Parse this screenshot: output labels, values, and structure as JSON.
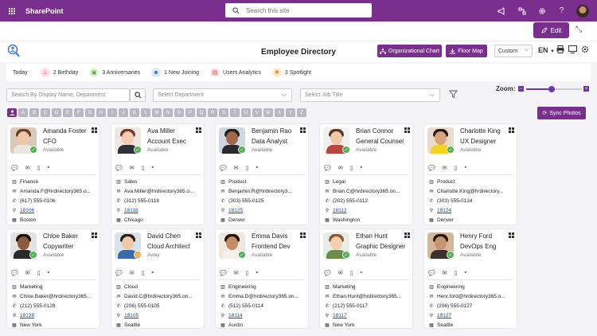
{
  "topbar": {
    "brand": "SharePoint",
    "search_placeholder": "Search this site"
  },
  "edit_label": "Edit",
  "header": {
    "title": "Employee Directory",
    "org_chart": "Organizational Chart",
    "floor_map": "Floor Map",
    "view": "Custom",
    "lang": "EN"
  },
  "tabs": [
    {
      "label": "Today"
    },
    {
      "label": "2 Birthday"
    },
    {
      "label": "3 Anniversaries"
    },
    {
      "label": "1 New Joining"
    },
    {
      "label": "Users Analytics"
    },
    {
      "label": "3 Spotlight"
    }
  ],
  "filters": {
    "search_placeholder": "Search By Display Name, Department",
    "department_placeholder": "Select Department",
    "job_placeholder": "Select Job Title"
  },
  "zoom": {
    "label": "Zoom:",
    "level": 0.45
  },
  "alphabet": [
    "A",
    "B",
    "C",
    "D",
    "E",
    "F",
    "G",
    "H",
    "I",
    "J",
    "K",
    "L",
    "M",
    "N",
    "O",
    "P",
    "Q",
    "R",
    "S",
    "T",
    "U",
    "V",
    "W",
    "X",
    "Y",
    "Z"
  ],
  "sync_label": "Sync Photos",
  "colors": {
    "brand": "#7a2f8e",
    "available": "#4caf50",
    "away": "#f0a020"
  },
  "employees": [
    {
      "name": "Amanda Foster",
      "job": "CFO",
      "status": "Available",
      "dept": "Finance",
      "email": "Amanda.F@hrdirectory365.o...",
      "phone": "(617) 555-0106",
      "room": "18106",
      "city": "Boston"
    },
    {
      "name": "Ava Miller",
      "job": "Account Exec",
      "status": "Available",
      "dept": "Sales",
      "email": "Ava.Miller@hrdirectory365.o...",
      "phone": "(312) 555-0118",
      "room": "18118",
      "city": "Chicago"
    },
    {
      "name": "Benjamin Rao",
      "job": "Data Analyst",
      "status": "Available",
      "dept": "Product",
      "email": "Benjamin.R@hrdirectory3...",
      "phone": "(303) 555-0125",
      "room": "18125",
      "city": "Denver"
    },
    {
      "name": "Brian Connor",
      "job": "General Counsel",
      "status": "Available",
      "dept": "Legal",
      "email": "Brian.C@hrdirectory365.on...",
      "phone": "(202) 555-0112",
      "room": "18112",
      "city": "Washington"
    },
    {
      "name": "Charlotte King",
      "job": "UX Designer",
      "status": "Available",
      "dept": "Product",
      "email": "Charlotte.King@hrdirectory...",
      "phone": "(303) 555-0124",
      "room": "18124",
      "city": "Denver"
    },
    {
      "name": "Chloe Baker",
      "job": "Copywriter",
      "status": "Available",
      "dept": "Marketing",
      "email": "Chloe.Baker@hrdirectory365...",
      "phone": "(212) 555-0128",
      "room": "18128",
      "city": "New York"
    },
    {
      "name": "David Chen",
      "job": "Cloud Architect",
      "status": "Away",
      "dept": "Cloud",
      "email": "David.C@hrdirectory365.on...",
      "phone": "(206) 555-0105",
      "room": "18105",
      "city": "Seattle"
    },
    {
      "name": "Emma Davis",
      "job": "Frontend Dev",
      "status": "Available",
      "dept": "Engineering",
      "email": "Emma.D@hrdirectory365.on...",
      "phone": "(512) 555-0114",
      "room": "18114",
      "city": "Austin"
    },
    {
      "name": "Ethan Hunt",
      "job": "Graphic Designer",
      "status": "Available",
      "dept": "Marketing",
      "email": "Ethan.Hunt@hrdirectory365...",
      "phone": "(212) 555-0117",
      "room": "18117",
      "city": "New York"
    },
    {
      "name": "Henry Ford",
      "job": "DevOps Eng",
      "status": "Available",
      "dept": "Engineering",
      "email": "Henr.ford@hrdirectory365.o...",
      "phone": "(206) 555-0127",
      "room": "18127",
      "city": "Seattle"
    }
  ]
}
